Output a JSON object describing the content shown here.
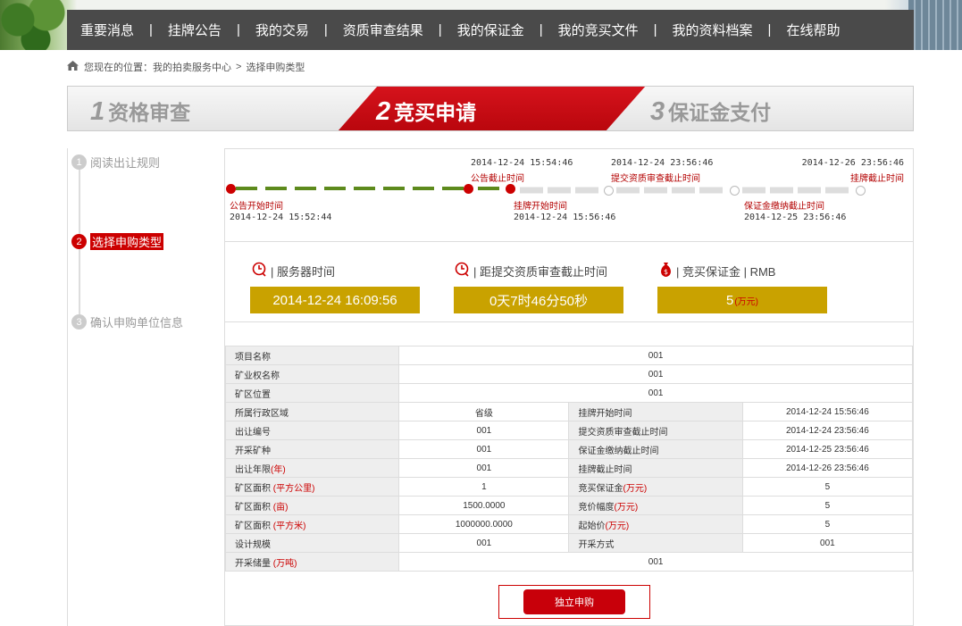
{
  "nav": [
    "重要消息",
    "挂牌公告",
    "我的交易",
    "资质审查结果",
    "我的保证金",
    "我的竞买文件",
    "我的资料档案",
    "在线帮助"
  ],
  "breadcrumb": {
    "prefix": "您现在的位置：",
    "home": "我的拍卖服务中心",
    "sep": ">",
    "current": "选择申购类型"
  },
  "steps": [
    {
      "num": "1",
      "label": "资格审查"
    },
    {
      "num": "2",
      "label": "竞买申请"
    },
    {
      "num": "3",
      "label": "保证金支付"
    }
  ],
  "sidebar": [
    {
      "num": "1",
      "label": "阅读出让规则"
    },
    {
      "num": "2",
      "label": "选择申购类型"
    },
    {
      "num": "3",
      "label": "确认申购单位信息"
    }
  ],
  "timeline": {
    "top": [
      {
        "time": "2014-12-24 15:54:46",
        "label": "公告截止时间"
      },
      {
        "time": "2014-12-24 23:56:46",
        "label": "提交资质审查截止时间"
      },
      {
        "time": "2014-12-26 23:56:46",
        "label": "挂牌截止时间"
      }
    ],
    "bottom": [
      {
        "label": "公告开始时间",
        "time": "2014-12-24 15:52:44"
      },
      {
        "label": "挂牌开始时间",
        "time": "2014-12-24 15:56:46"
      },
      {
        "label": "保证金缴纳截止时间",
        "time": "2014-12-25 23:56:46"
      }
    ]
  },
  "info": {
    "server_label": "| 服务器时间",
    "server_value": "2014-12-24 16:09:56",
    "remain_label": "| 距提交资质审查截止时间",
    "remain_value": "0天7时46分50秒",
    "deposit_label": "| 竞买保证金 | RMB",
    "deposit_value": "5",
    "deposit_unit": "(万元)"
  },
  "table": {
    "r1": {
      "k": "项目名称",
      "v": "001"
    },
    "r2": {
      "k": "矿业权名称",
      "v": "001"
    },
    "r3": {
      "k": "矿区位置",
      "v": "001"
    },
    "r4": {
      "k": "所属行政区域",
      "v": "省级",
      "k2": "挂牌开始时间",
      "v2": "2014-12-24 15:56:46"
    },
    "r5": {
      "k": "出让编号",
      "v": "001",
      "k2": "提交资质审查截止时间",
      "v2": "2014-12-24 23:56:46"
    },
    "r6": {
      "k": "开采矿种",
      "v": "001",
      "k2": "保证金缴纳截止时间",
      "v2": "2014-12-25 23:56:46"
    },
    "r7": {
      "k": "出让年限",
      "ku": "(年)",
      "v": "001",
      "k2": "挂牌截止时间",
      "v2": "2014-12-26 23:56:46"
    },
    "r8": {
      "k": "矿区面积",
      "ku": "(平方公里)",
      "v": "1",
      "k2": "竞买保证金",
      "k2u": "(万元)",
      "v2": "5"
    },
    "r9": {
      "k": "矿区面积",
      "ku": "(亩)",
      "v": "1500.0000",
      "k2": "竞价幅度",
      "k2u": "(万元)",
      "v2": "5"
    },
    "r10": {
      "k": "矿区面积",
      "ku": "(平方米)",
      "v": "1000000.0000",
      "k2": "起始价",
      "k2u": "(万元)",
      "v2": "5"
    },
    "r11": {
      "k": "设计规模",
      "v": "001",
      "k2": "开采方式",
      "v2": "001"
    },
    "r12": {
      "k": "开采储量",
      "ku": "(万吨)",
      "v": "001"
    }
  },
  "submit": "独立申购"
}
